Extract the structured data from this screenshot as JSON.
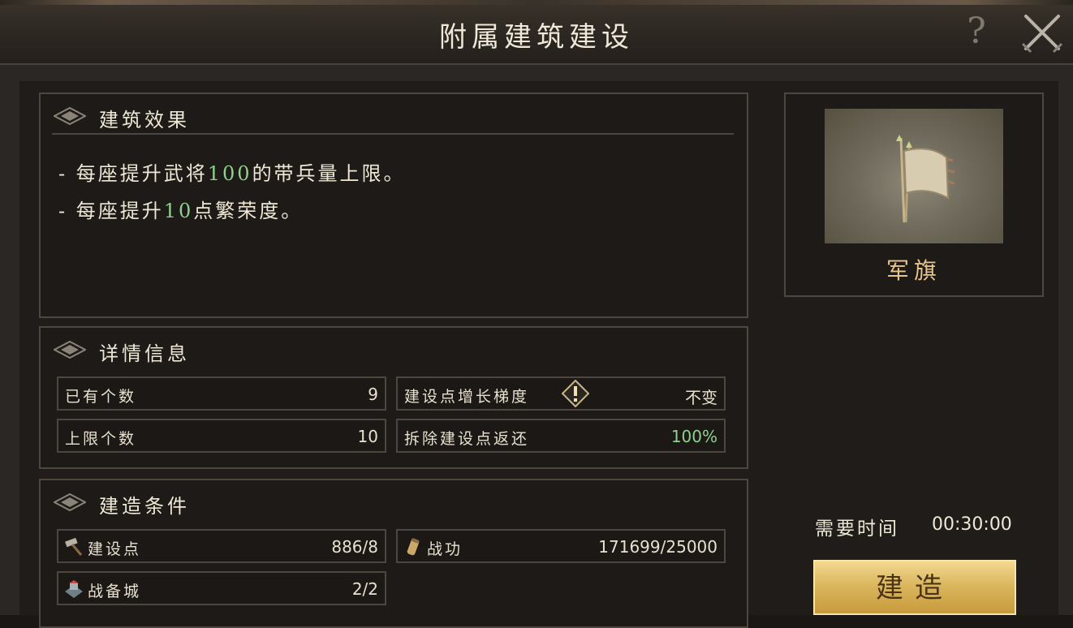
{
  "header": {
    "title": "附属建筑建设",
    "help_glyph": "?"
  },
  "effects": {
    "section_title": "建筑效果",
    "lines": [
      {
        "prefix": "- 每座提升武将",
        "value": "100",
        "suffix": "的带兵量上限。"
      },
      {
        "prefix": "- 每座提升",
        "value": "10",
        "suffix": "点繁荣度。"
      }
    ]
  },
  "details": {
    "section_title": "详情信息",
    "owned_label": "已有个数",
    "owned_value": "9",
    "limit_label": "上限个数",
    "limit_value": "10",
    "growth_label": "建设点增长梯度",
    "growth_value": "不变",
    "refund_label": "拆除建设点返还",
    "refund_value": "100%"
  },
  "conditions": {
    "section_title": "建造条件",
    "build_points_label": "建设点",
    "build_points_value": "886/8",
    "merit_label": "战功",
    "merit_value": "171699/25000",
    "city_label": "战备城",
    "city_value": "2/2"
  },
  "building": {
    "name": "军旗"
  },
  "build": {
    "time_label": "需要时间",
    "time_value": "00:30:00",
    "button_label": "建造"
  },
  "colors": {
    "highlight_green": "#8fd18c",
    "gold_name": "#e7c789",
    "button_gold": "#d9b45a"
  },
  "icons": [
    "help-icon",
    "close-icon",
    "section-diamond-icon",
    "warning-icon",
    "hammer-icon",
    "scroll-icon",
    "city-icon"
  ]
}
